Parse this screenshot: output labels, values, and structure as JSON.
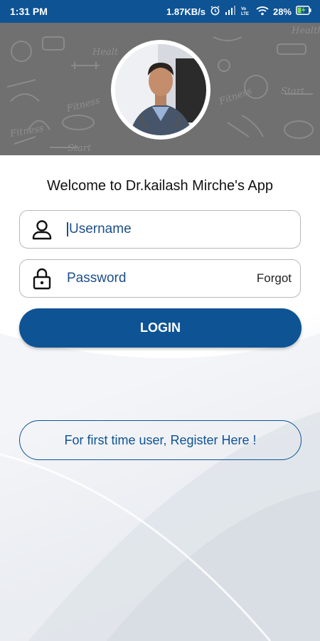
{
  "status_bar": {
    "time": "1:31 PM",
    "network_speed": "1.87KB/s",
    "battery": "28%",
    "icons": [
      "alarm-icon",
      "signal-icon",
      "volte-icon",
      "wifi-icon",
      "battery-icon"
    ]
  },
  "header": {
    "avatar_icon": "doctor-avatar"
  },
  "welcome_text": "Welcome to Dr.kailash Mirche's App",
  "username": {
    "placeholder": "Username",
    "icon": "user-icon"
  },
  "password": {
    "placeholder": "Password",
    "icon": "lock-icon",
    "forgot_label": "Forgot"
  },
  "login_label": "LOGIN",
  "register_label": "For first time user, Register Here !",
  "colors": {
    "primary": "#0e5394",
    "text_blue": "#1d4f8b"
  }
}
